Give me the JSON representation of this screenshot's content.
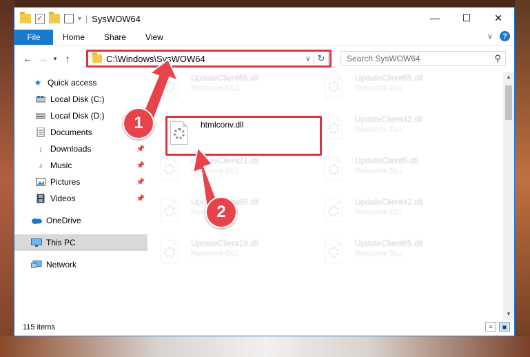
{
  "window": {
    "title": "SysWOW64"
  },
  "ribbon": {
    "tabs": [
      "File",
      "Home",
      "Share",
      "View"
    ],
    "help_label": "?"
  },
  "address": {
    "path": "C:\\Windows\\SysWOW64",
    "search_placeholder": "Search SysWOW64"
  },
  "nav": {
    "items": [
      {
        "label": "Quick access",
        "icon": "star-icon",
        "pinned": false
      },
      {
        "label": "Local Disk (C:)",
        "icon": "drive-icon",
        "pinned": false
      },
      {
        "label": "Local Disk (D:)",
        "icon": "drive-icon",
        "pinned": false
      },
      {
        "label": "Documents",
        "icon": "documents-icon",
        "pinned": true
      },
      {
        "label": "Downloads",
        "icon": "download-arrow-icon",
        "pinned": true
      },
      {
        "label": "Music",
        "icon": "music-note-icon",
        "pinned": true
      },
      {
        "label": "Pictures",
        "icon": "pictures-icon",
        "pinned": true
      },
      {
        "label": "Videos",
        "icon": "film-icon",
        "pinned": true
      },
      {
        "label": "OneDrive",
        "icon": "cloud-icon",
        "pinned": false
      },
      {
        "label": "This PC",
        "icon": "monitor-icon",
        "pinned": false,
        "selected": true
      },
      {
        "label": "Network",
        "icon": "network-icon",
        "pinned": false
      }
    ]
  },
  "files": [
    {
      "name": "UpdateClient65.dll",
      "type": "Resource DLL",
      "faded": true
    },
    {
      "name": "UpdateClient65.dll",
      "type": "Resource DLL",
      "faded": true
    },
    {
      "name": "htmlconv.dll",
      "type": "",
      "faded": false,
      "highlighted": true
    },
    {
      "name": "UpdateClient42.dll",
      "type": "Resource DLL",
      "faded": true
    },
    {
      "name": "UpdateClient21.dll",
      "type": "Resource DLL",
      "faded": true
    },
    {
      "name": "UpdateClient5.dll",
      "type": "Resource DLL",
      "faded": true
    },
    {
      "name": "UpdateClient65.dll",
      "type": "Resource DLL",
      "faded": true
    },
    {
      "name": "UpdateClient42.dll",
      "type": "Resource DLL",
      "faded": true
    },
    {
      "name": "UpdateClient19.dll",
      "type": "Resource DLL",
      "faded": true
    },
    {
      "name": "UpdateClient65.dll",
      "type": "Resource DLL",
      "faded": true
    }
  ],
  "status": {
    "item_count": "115 items"
  },
  "annotations": {
    "step1": "1",
    "step2": "2",
    "color": "#e8434a"
  },
  "colors": {
    "accent": "#1979ca",
    "highlight_box": "#d9363e"
  }
}
